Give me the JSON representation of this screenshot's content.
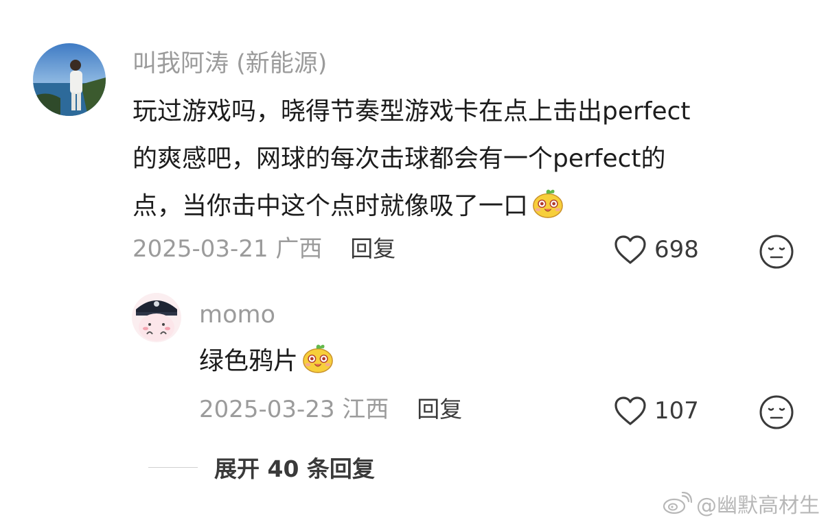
{
  "comment": {
    "username": "叫我阿涛 (新能源)",
    "text_lines": [
      "玩过游戏吗，晓得节奏型游戏卡在点上击出perfect",
      "的爽感吧，网球的每次击球都会有一个perfect的",
      "点，当你击中这个点时就像吸了一口"
    ],
    "date": "2025-03-21",
    "location": "广西",
    "reply_label": "回复",
    "like_count": "698",
    "inline_emoji": "smirk-potato-emoji"
  },
  "reply": {
    "username": "momo",
    "text": "绿色鸦片",
    "date": "2025-03-23",
    "location": "江西",
    "reply_label": "回复",
    "like_count": "107",
    "inline_emoji": "smirk-potato-emoji"
  },
  "expand_replies": "展开 40 条回复",
  "watermark": "@幽默高材生",
  "colors": {
    "muted_text": "#9b9b9b",
    "body_text": "#1c1c1c",
    "action_text": "#3a3a3a",
    "emoji_yellow": "#f7cf3b"
  }
}
